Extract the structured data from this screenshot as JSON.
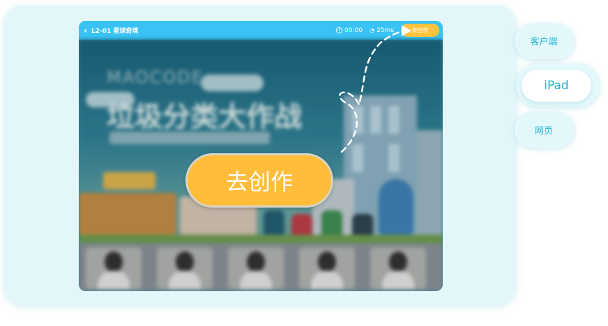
{
  "topbar": {
    "back_icon": "chevron-left-icon",
    "title": "L2-01 星球奇境",
    "timer": "00:00",
    "latency": "25ms",
    "create_label": "去创作"
  },
  "scene": {
    "brand": "MAOCODE",
    "banner": "垃圾分类大作战",
    "create_label": "去创作"
  },
  "platforms": {
    "client": "客户端",
    "ipad": "iPad",
    "web": "网页"
  },
  "colors": {
    "accent": "#39c3f4",
    "button": "#ffc43d",
    "pill_text": "#1fb6d0"
  }
}
